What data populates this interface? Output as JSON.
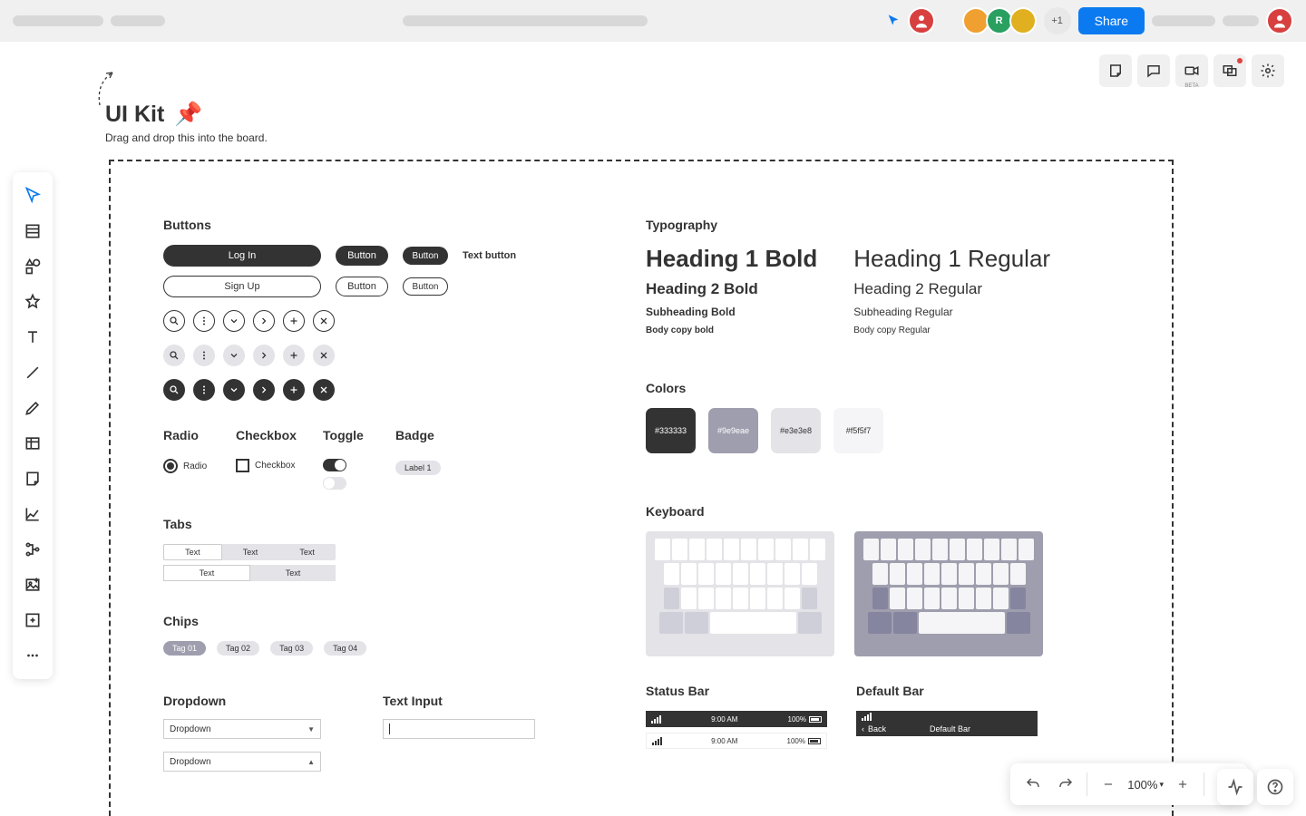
{
  "topbar": {
    "plus_count": "+1",
    "share": "Share",
    "avatar_letter": "R"
  },
  "canvas": {
    "title": "UI Kit",
    "pin": "📌",
    "subtitle": "Drag and drop this into the board."
  },
  "sections": {
    "buttons": "Buttons",
    "typography": "Typography",
    "colors": "Colors",
    "radio": "Radio",
    "checkbox": "Checkbox",
    "toggle": "Toggle",
    "badge": "Badge",
    "tabs": "Tabs",
    "chips": "Chips",
    "keyboard": "Keyboard",
    "dropdown": "Dropdown",
    "text_input": "Text Input",
    "status_bar": "Status Bar",
    "default_bar": "Default Bar"
  },
  "buttons": {
    "login": "Log In",
    "signup": "Sign Up",
    "button": "Button",
    "text_button": "Text button"
  },
  "controls": {
    "radio_label": "Radio",
    "checkbox_label": "Checkbox",
    "badge_label": "Label 1"
  },
  "tabs": {
    "text": "Text"
  },
  "chips": {
    "items": [
      "Tag 01",
      "Tag 02",
      "Tag 03",
      "Tag 04"
    ]
  },
  "dropdown": {
    "value": "Dropdown",
    "caret_down": "▼",
    "caret_up": "▲"
  },
  "typography": {
    "h1b": "Heading 1 Bold",
    "h1r": "Heading 1 Regular",
    "h2b": "Heading 2 Bold",
    "h2r": "Heading 2 Regular",
    "shb": "Subheading Bold",
    "shr": "Subheading Regular",
    "bb": "Body copy bold",
    "br": "Body copy Regular"
  },
  "colors": {
    "c1": "#333333",
    "c2": "#9e9eae",
    "c3": "#e3e3e8",
    "c4": "#f5f5f7"
  },
  "status": {
    "time": "9:00 AM",
    "pct": "100%"
  },
  "default_bar": {
    "back": "Back",
    "title": "Default Bar"
  },
  "zoom": {
    "value": "100%"
  },
  "beta": "BETA"
}
